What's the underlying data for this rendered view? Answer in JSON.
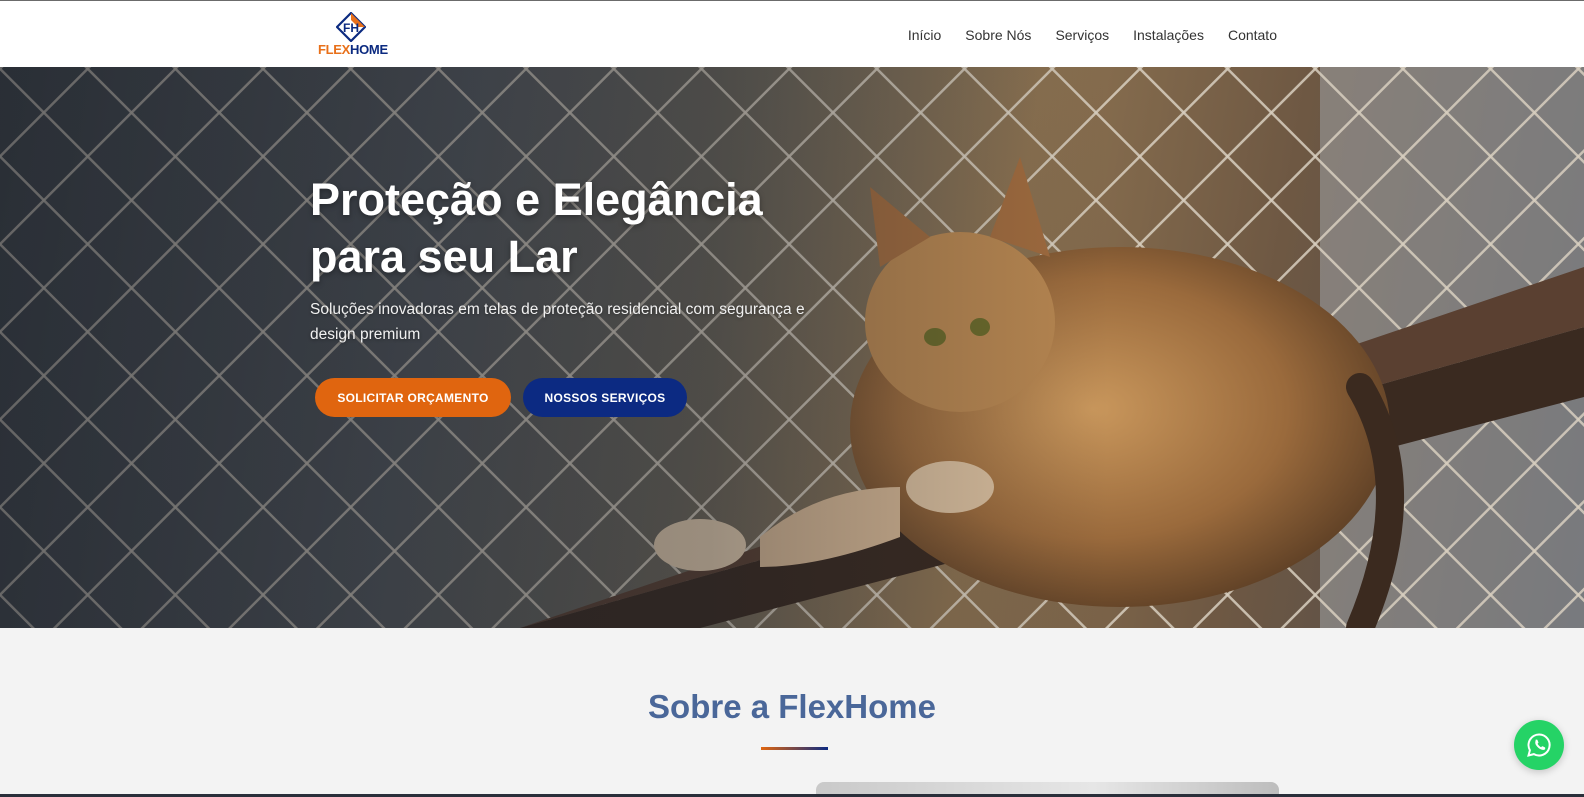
{
  "header": {
    "logo": {
      "part1": "FLEX",
      "part2": "HOME"
    },
    "nav": [
      {
        "label": "Início"
      },
      {
        "label": "Sobre Nós"
      },
      {
        "label": "Serviços"
      },
      {
        "label": "Instalações"
      },
      {
        "label": "Contato"
      }
    ]
  },
  "hero": {
    "title_line1": "Proteção e Elegância",
    "title_line2": "para seu Lar",
    "subtitle": "Soluções inovadoras em telas de proteção residencial com segurança e design premium",
    "primary_button": "SOLICITAR ORÇAMENTO",
    "secondary_button": "NOSSOS SERVIÇOS",
    "image_subject": "cat-on-balcony-with-safety-net"
  },
  "about": {
    "title": "Sobre a FlexHome"
  },
  "floating": {
    "whatsapp_icon": "whatsapp-icon"
  },
  "colors": {
    "accent_orange": "#e0650f",
    "brand_blue": "#0c2a82",
    "heading_blue": "#4a6799",
    "whatsapp_green": "#25d366"
  }
}
